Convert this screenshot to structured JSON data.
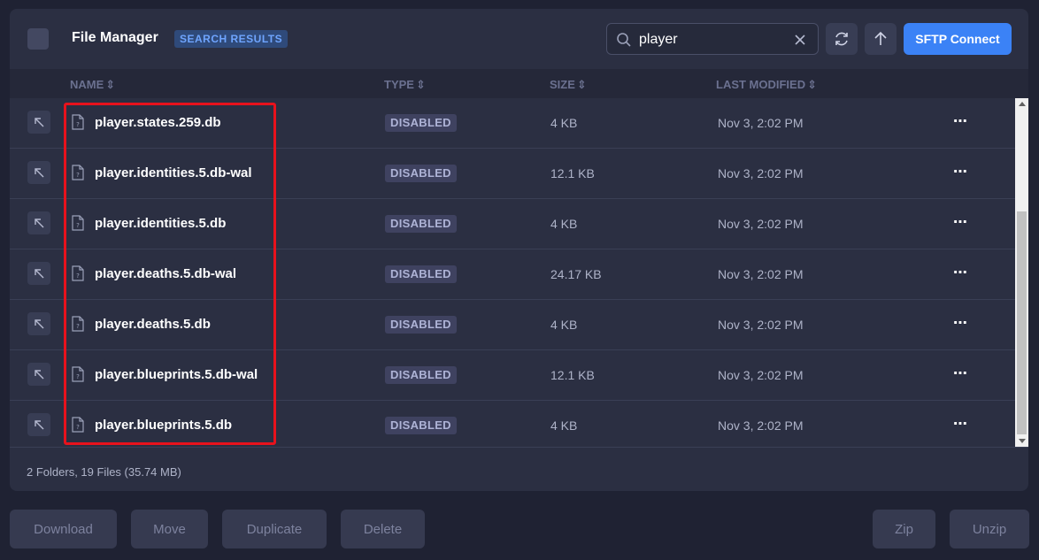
{
  "header": {
    "title": "File Manager",
    "badge": "SEARCH RESULTS",
    "search_value": "player",
    "sftp_label": "SFTP Connect"
  },
  "columns": {
    "name": "NAME",
    "type": "TYPE",
    "size": "SIZE",
    "modified": "LAST MODIFIED"
  },
  "files": [
    {
      "name": "player.states.259.db",
      "type": "DISABLED",
      "size": "4 KB",
      "modified": "Nov 3, 2:02 PM"
    },
    {
      "name": "player.identities.5.db-wal",
      "type": "DISABLED",
      "size": "12.1 KB",
      "modified": "Nov 3, 2:02 PM"
    },
    {
      "name": "player.identities.5.db",
      "type": "DISABLED",
      "size": "4 KB",
      "modified": "Nov 3, 2:02 PM"
    },
    {
      "name": "player.deaths.5.db-wal",
      "type": "DISABLED",
      "size": "24.17 KB",
      "modified": "Nov 3, 2:02 PM"
    },
    {
      "name": "player.deaths.5.db",
      "type": "DISABLED",
      "size": "4 KB",
      "modified": "Nov 3, 2:02 PM"
    },
    {
      "name": "player.blueprints.5.db-wal",
      "type": "DISABLED",
      "size": "12.1 KB",
      "modified": "Nov 3, 2:02 PM"
    },
    {
      "name": "player.blueprints.5.db",
      "type": "DISABLED",
      "size": "4 KB",
      "modified": "Nov 3, 2:02 PM"
    }
  ],
  "footer": {
    "summary": "2 Folders, 19 Files (35.74 MB)"
  },
  "actions": {
    "download": "Download",
    "move": "Move",
    "duplicate": "Duplicate",
    "delete": "Delete",
    "zip": "Zip",
    "unzip": "Unzip"
  },
  "colors": {
    "accent": "#3b82f6",
    "highlight": "#e8121c",
    "background": "#1f2233",
    "panel": "#2b2f42"
  },
  "icons": {
    "search": "search-icon",
    "clear": "close-icon",
    "refresh": "refresh-icon",
    "upload": "arrow-up-icon",
    "row_action": "arrow-up-left-icon",
    "file": "file-unknown-icon",
    "more": "more-horizontal-icon"
  }
}
